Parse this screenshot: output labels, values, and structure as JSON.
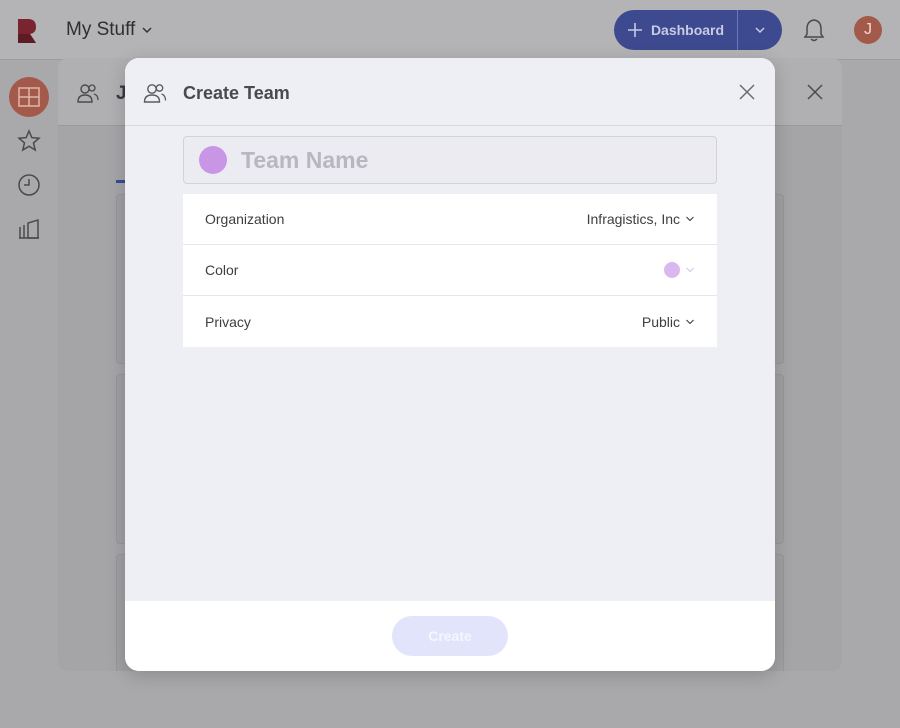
{
  "topbar": {
    "workspace_label": "My Stuff",
    "dashboard_button_label": "Dashboard",
    "user_initial": "J"
  },
  "background_modal": {
    "title_initial": "J"
  },
  "create_team_modal": {
    "title": "Create Team",
    "team_name": {
      "value": "",
      "placeholder": "Team Name",
      "color": "#c996e6"
    },
    "settings": [
      {
        "label": "Organization",
        "value": "Infragistics, Inc"
      },
      {
        "label": "Color",
        "value_color": "#d9b8ef"
      },
      {
        "label": "Privacy",
        "value": "Public"
      }
    ],
    "create_button_label": "Create"
  },
  "colors": {
    "accent": "#3d4a8f",
    "create_button_disabled": "#e1e4fb",
    "avatar": "#a35a4a"
  }
}
